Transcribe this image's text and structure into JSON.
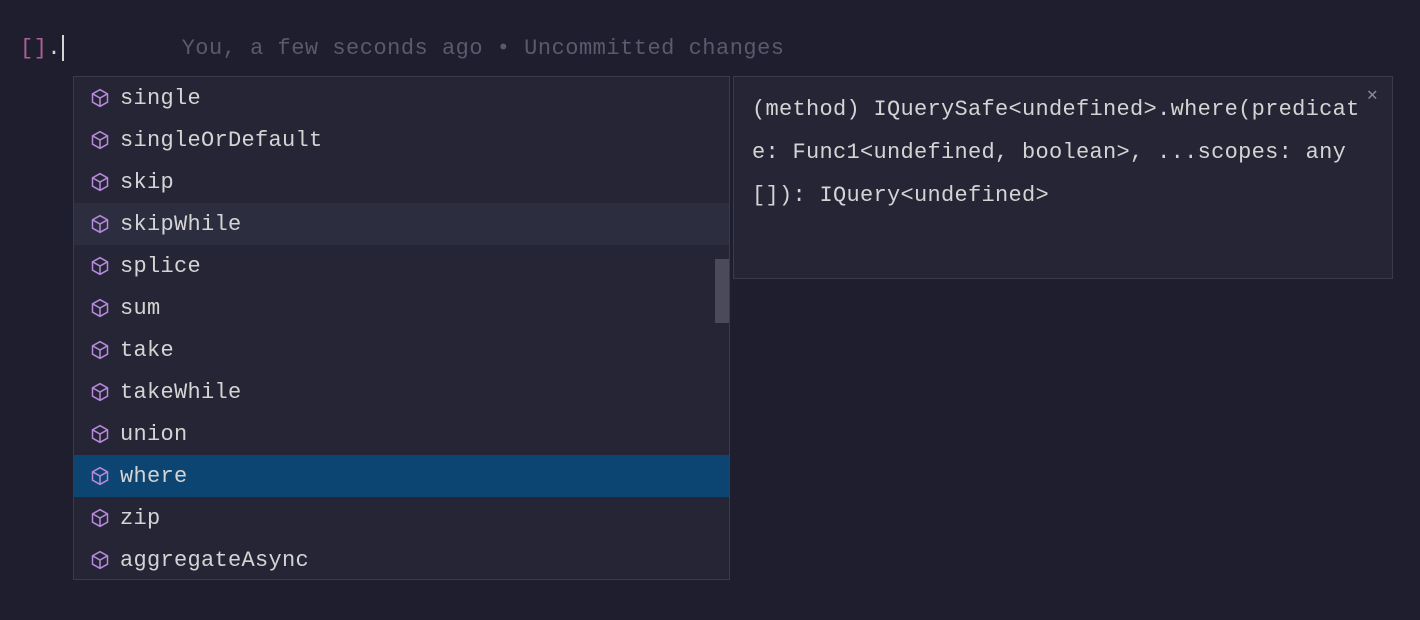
{
  "editor": {
    "code_prefix": "[]",
    "code_dot": ".",
    "git_blame": "You, a few seconds ago • Uncommitted changes"
  },
  "completion": {
    "items": [
      {
        "label": "single",
        "selected": false,
        "highlighted": false
      },
      {
        "label": "singleOrDefault",
        "selected": false,
        "highlighted": false
      },
      {
        "label": "skip",
        "selected": false,
        "highlighted": false
      },
      {
        "label": "skipWhile",
        "selected": false,
        "highlighted": true
      },
      {
        "label": "splice",
        "selected": false,
        "highlighted": false
      },
      {
        "label": "sum",
        "selected": false,
        "highlighted": false
      },
      {
        "label": "take",
        "selected": false,
        "highlighted": false
      },
      {
        "label": "takeWhile",
        "selected": false,
        "highlighted": false
      },
      {
        "label": "union",
        "selected": false,
        "highlighted": false
      },
      {
        "label": "where",
        "selected": true,
        "highlighted": false
      },
      {
        "label": "zip",
        "selected": false,
        "highlighted": false
      },
      {
        "label": "aggregateAsync",
        "selected": false,
        "highlighted": false
      }
    ]
  },
  "doc": {
    "content": "(method) IQuerySafe<undefined>.where(predicate: Func1<undefined, boolean>, ...scopes: any[]): IQuery<undefined>",
    "close_label": "✕"
  },
  "colors": {
    "bg": "#1e1e2e",
    "popup_bg": "#252535",
    "border": "#3a3a4a",
    "text": "#d4d4d4",
    "muted": "#5a5a6e",
    "selected": "#0d4572",
    "highlighted": "#2d2d40",
    "icon": "#b88add",
    "brackets": "#b05d9a"
  }
}
